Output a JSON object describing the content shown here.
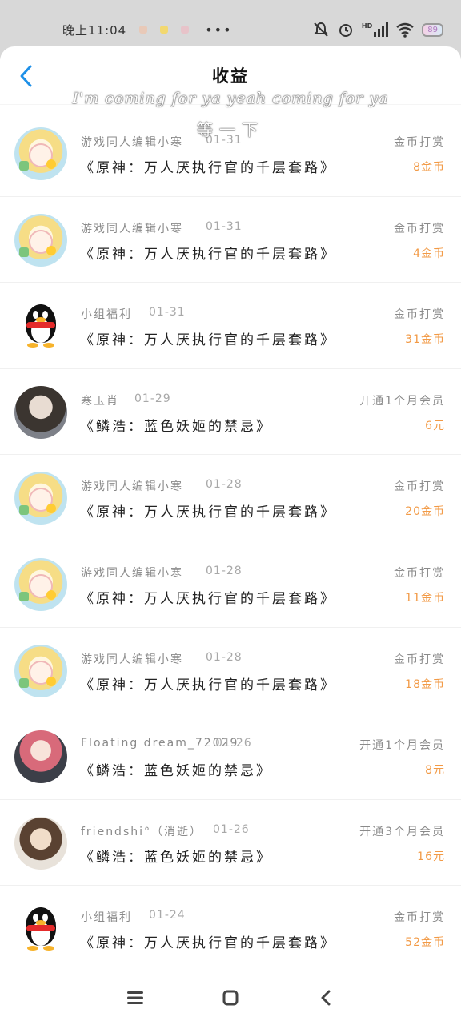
{
  "status_bar": {
    "time": "晚上11:04",
    "dots": "•••",
    "network_label": "HD",
    "battery": "89"
  },
  "header": {
    "title": "收益",
    "back_icon": "chevron-left-icon"
  },
  "overlay": {
    "line1": "I'm coming for ya yeah coming for ya",
    "line2": "等一下"
  },
  "records": [
    {
      "name": "游戏同人编辑小寒",
      "date": "01-31",
      "book": "《原神：万人厌执行官的千层套路》",
      "type": "金币打赏",
      "amount": "8金币",
      "avatar": "anime"
    },
    {
      "name": "游戏同人编辑小寒",
      "date": "01-31",
      "book": "《原神：万人厌执行官的千层套路》",
      "type": "金币打赏",
      "amount": "4金币",
      "avatar": "anime"
    },
    {
      "name": "小组福利",
      "date": "01-31",
      "book": "《原神：万人厌执行官的千层套路》",
      "type": "金币打赏",
      "amount": "31金币",
      "avatar": "qq"
    },
    {
      "name": "寒玉肖",
      "date": "01-29",
      "book": "《鳞浩：蓝色妖姬的禁忌》",
      "type": "开通1个月会员",
      "amount": "6元",
      "avatar": "dark"
    },
    {
      "name": "游戏同人编辑小寒",
      "date": "01-28",
      "book": "《原神：万人厌执行官的千层套路》",
      "type": "金币打赏",
      "amount": "20金币",
      "avatar": "anime"
    },
    {
      "name": "游戏同人编辑小寒",
      "date": "01-28",
      "book": "《原神：万人厌执行官的千层套路》",
      "type": "金币打赏",
      "amount": "11金币",
      "avatar": "anime"
    },
    {
      "name": "游戏同人编辑小寒",
      "date": "01-28",
      "book": "《原神：万人厌执行官的千层套路》",
      "type": "金币打赏",
      "amount": "18金币",
      "avatar": "anime"
    },
    {
      "name": "Floating dream_72029",
      "date": "01-26",
      "book": "《鳞浩：蓝色妖姬的禁忌》",
      "type": "开通1个月会员",
      "amount": "8元",
      "avatar": "pink"
    },
    {
      "name": "friendshi°（消逝）",
      "date": "01-26",
      "book": "《鳞浩：蓝色妖姬的禁忌》",
      "type": "开通3个月会员",
      "amount": "16元",
      "avatar": "man"
    },
    {
      "name": "小组福利",
      "date": "01-24",
      "book": "《原神：万人厌执行官的千层套路》",
      "type": "金币打赏",
      "amount": "52金币",
      "avatar": "qq"
    }
  ],
  "nav_bar": {
    "menu_icon": "menu-icon",
    "home_icon": "home-square-icon",
    "back_icon": "back-triangle-icon"
  },
  "colors": {
    "accent_blue": "#1e90e8",
    "amount_orange": "#f29a46",
    "secondary_text": "#8a8a8a"
  }
}
